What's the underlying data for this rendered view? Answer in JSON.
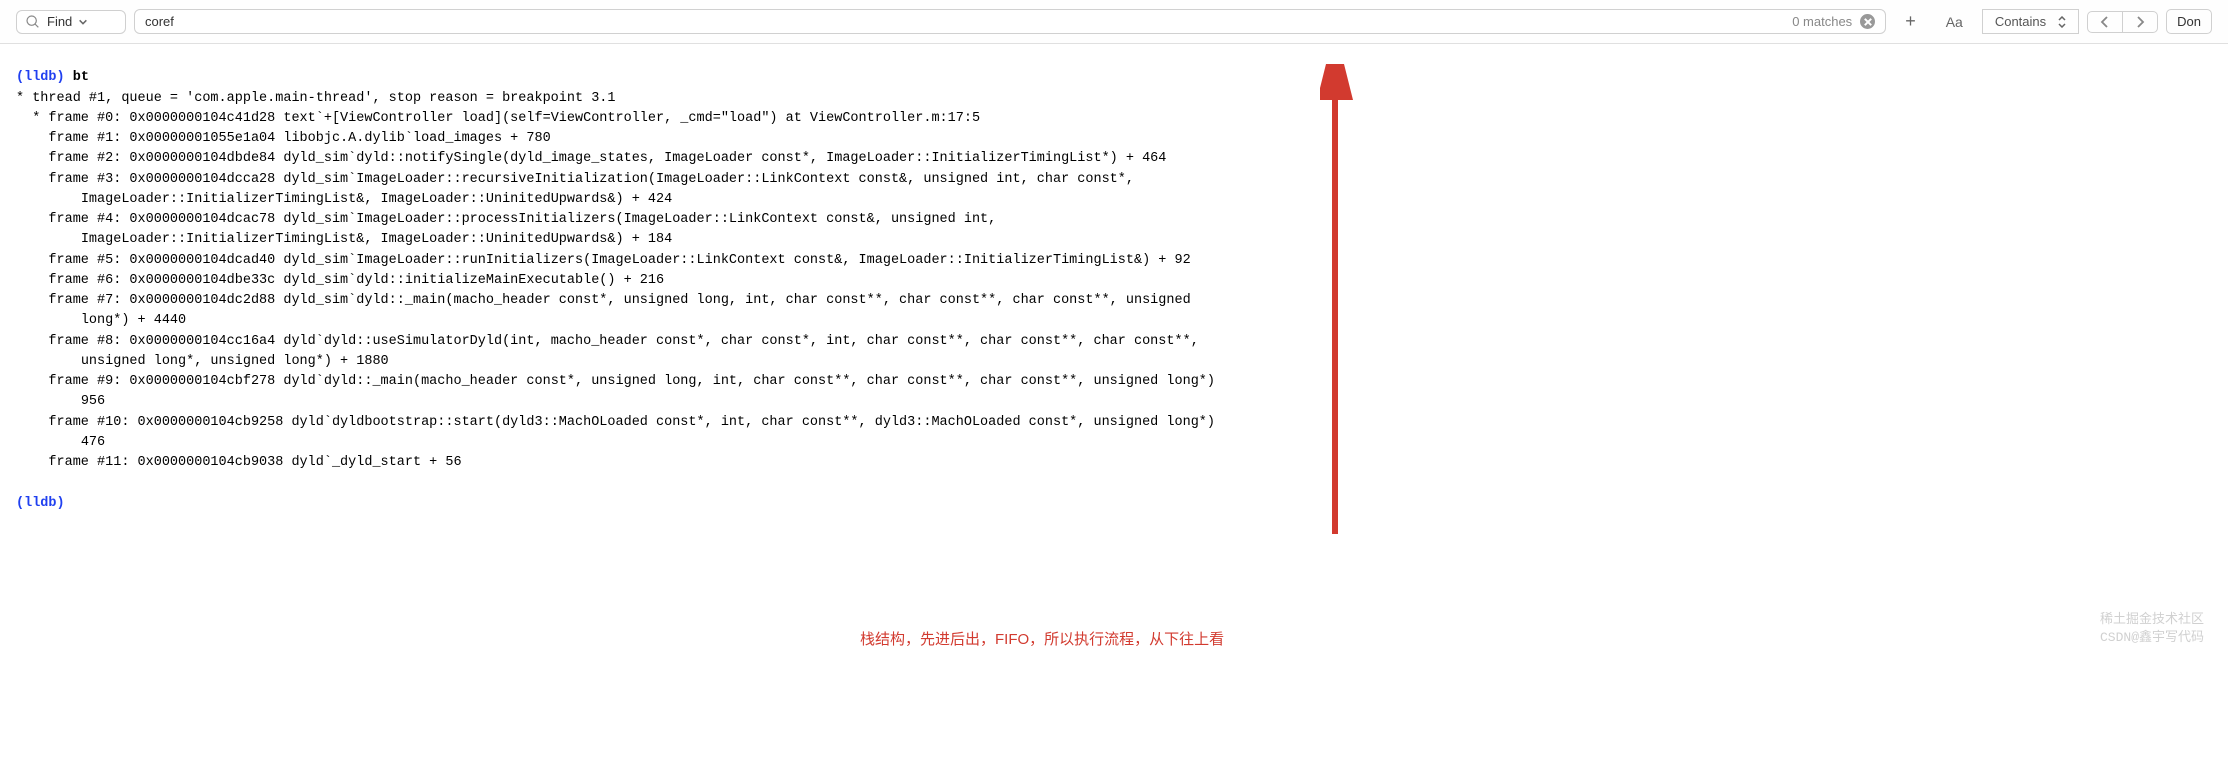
{
  "toolbar": {
    "find_label": "Find",
    "search_value": "coref",
    "matches_label": "0 matches",
    "plus_label": "+",
    "case_label": "Aa",
    "contains_label": "Contains",
    "done_label": "Don"
  },
  "console": {
    "prompt": "(lldb)",
    "command": "bt",
    "lines": [
      "* thread #1, queue = 'com.apple.main-thread', stop reason = breakpoint 3.1",
      "  * frame #0: 0x0000000104c41d28 text`+[ViewController load](self=ViewController, _cmd=\"load\") at ViewController.m:17:5",
      "    frame #1: 0x00000001055e1a04 libobjc.A.dylib`load_images + 780",
      "    frame #2: 0x0000000104dbde84 dyld_sim`dyld::notifySingle(dyld_image_states, ImageLoader const*, ImageLoader::InitializerTimingList*) + 464",
      "    frame #3: 0x0000000104dcca28 dyld_sim`ImageLoader::recursiveInitialization(ImageLoader::LinkContext const&, unsigned int, char const*,",
      "        ImageLoader::InitializerTimingList&, ImageLoader::UninitedUpwards&) + 424",
      "    frame #4: 0x0000000104dcac78 dyld_sim`ImageLoader::processInitializers(ImageLoader::LinkContext const&, unsigned int,",
      "        ImageLoader::InitializerTimingList&, ImageLoader::UninitedUpwards&) + 184",
      "    frame #5: 0x0000000104dcad40 dyld_sim`ImageLoader::runInitializers(ImageLoader::LinkContext const&, ImageLoader::InitializerTimingList&) + 92",
      "    frame #6: 0x0000000104dbe33c dyld_sim`dyld::initializeMainExecutable() + 216",
      "    frame #7: 0x0000000104dc2d88 dyld_sim`dyld::_main(macho_header const*, unsigned long, int, char const**, char const**, char const**, unsigned",
      "        long*) + 4440",
      "    frame #8: 0x0000000104cc16a4 dyld`dyld::useSimulatorDyld(int, macho_header const*, char const*, int, char const**, char const**, char const**,",
      "        unsigned long*, unsigned long*) + 1880",
      "    frame #9: 0x0000000104cbf278 dyld`dyld::_main(macho_header const*, unsigned long, int, char const**, char const**, char const**, unsigned long*)",
      "        956",
      "    frame #10: 0x0000000104cb9258 dyld`dyldbootstrap::start(dyld3::MachOLoaded const*, int, char const**, dyld3::MachOLoaded const*, unsigned long*)",
      "        476",
      "    frame #11: 0x0000000104cb9038 dyld`_dyld_start + 56"
    ]
  },
  "annotation": {
    "text": "栈结构，先进后出，FIFO，所以执行流程，从下往上看"
  },
  "watermarks": {
    "w1": "稀土掘金技术社区",
    "w2": "CSDN@鑫宇写代码"
  }
}
